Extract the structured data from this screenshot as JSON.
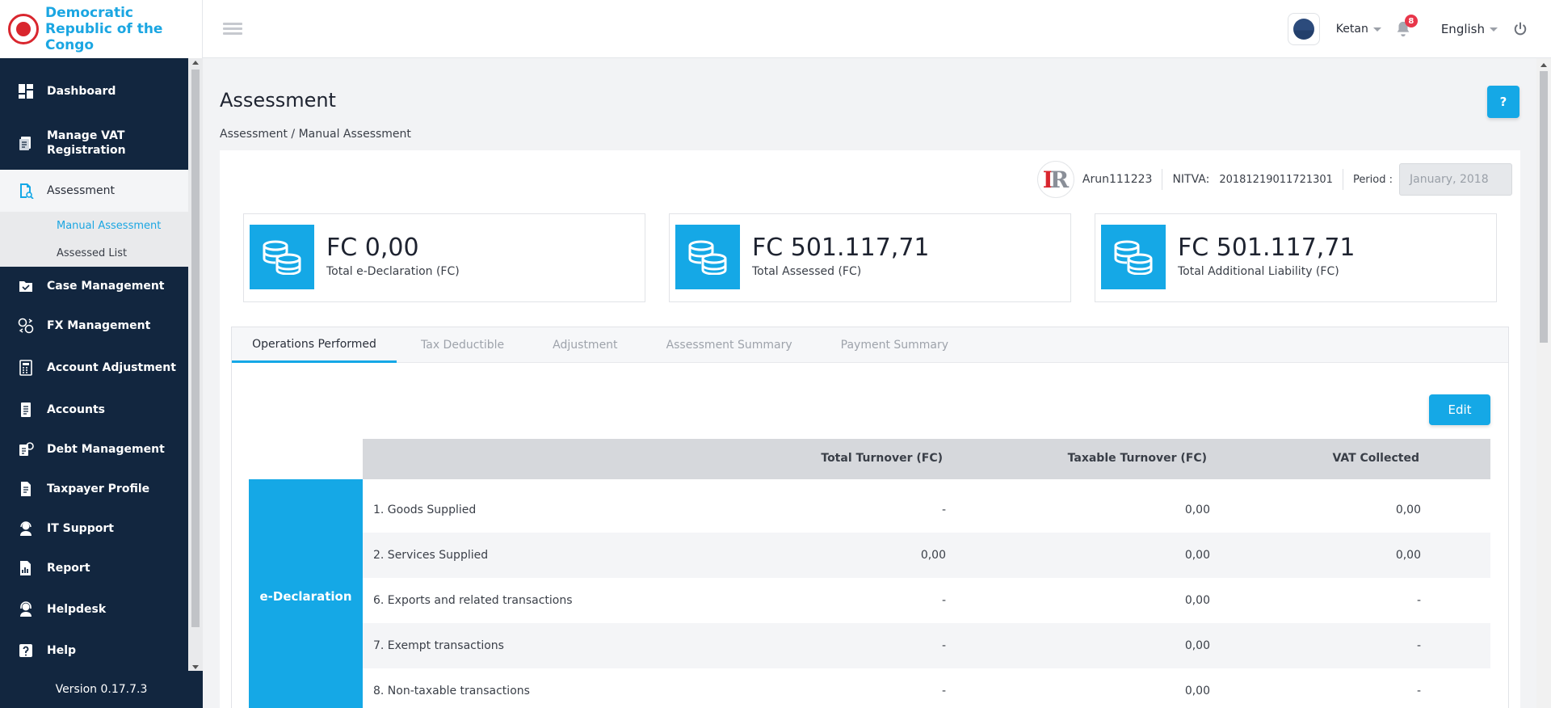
{
  "brand": {
    "name": "Democratic Republic of the Congo"
  },
  "header": {
    "user_name": "Ketan",
    "notification_count": "8",
    "language": "English"
  },
  "sidebar": {
    "items": [
      {
        "label": "Dashboard"
      },
      {
        "label": "Manage VAT Registration"
      },
      {
        "label": "Assessment"
      },
      {
        "label": "Case Management"
      },
      {
        "label": "FX Management"
      },
      {
        "label": "Account Adjustment"
      },
      {
        "label": "Accounts"
      },
      {
        "label": "Debt Management"
      },
      {
        "label": "Taxpayer Profile"
      },
      {
        "label": "IT Support"
      },
      {
        "label": "Report"
      },
      {
        "label": "Helpdesk"
      },
      {
        "label": "Help"
      }
    ],
    "sub_items": [
      {
        "label": "Manual Assessment"
      },
      {
        "label": "Assessed List"
      }
    ],
    "version": "Version 0.17.7.3"
  },
  "page": {
    "title": "Assessment",
    "help_label": "?",
    "breadcrumb": "Assessment / Manual Assessment"
  },
  "taxpayer": {
    "name": "Arun111223",
    "nitva_label": "NITVA:",
    "nitva": "20181219011721301",
    "period_label": "Period :",
    "period_value": "January, 2018"
  },
  "stats": [
    {
      "value": "FC 0,00",
      "label": "Total e-Declaration (FC)"
    },
    {
      "value": "FC 501.117,71",
      "label": "Total Assessed (FC)"
    },
    {
      "value": "FC 501.117,71",
      "label": "Total Additional Liability (FC)"
    }
  ],
  "tabs": [
    {
      "label": "Operations Performed"
    },
    {
      "label": "Tax Deductible"
    },
    {
      "label": "Adjustment"
    },
    {
      "label": "Assessment Summary"
    },
    {
      "label": "Payment Summary"
    }
  ],
  "edit_label": "Edit",
  "table": {
    "columns": [
      "Total Turnover (FC)",
      "Taxable Turnover (FC)",
      "VAT Collected"
    ],
    "group_label": "e-Declaration",
    "rows": [
      {
        "label": "1. Goods Supplied",
        "total": "-",
        "taxable": "0,00",
        "vat": "0,00"
      },
      {
        "label": "2. Services Supplied",
        "total": "0,00",
        "taxable": "0,00",
        "vat": "0,00"
      },
      {
        "label": "6. Exports and related transactions",
        "total": "-",
        "taxable": "0,00",
        "vat": "-"
      },
      {
        "label": "7. Exempt transactions",
        "total": "-",
        "taxable": "0,00",
        "vat": "-"
      },
      {
        "label": "8. Non-taxable transactions",
        "total": "-",
        "taxable": "0,00",
        "vat": "-"
      }
    ]
  },
  "colors": {
    "accent": "#15a8e6",
    "sidebar": "#12263f",
    "brand_red": "#d9262e"
  }
}
